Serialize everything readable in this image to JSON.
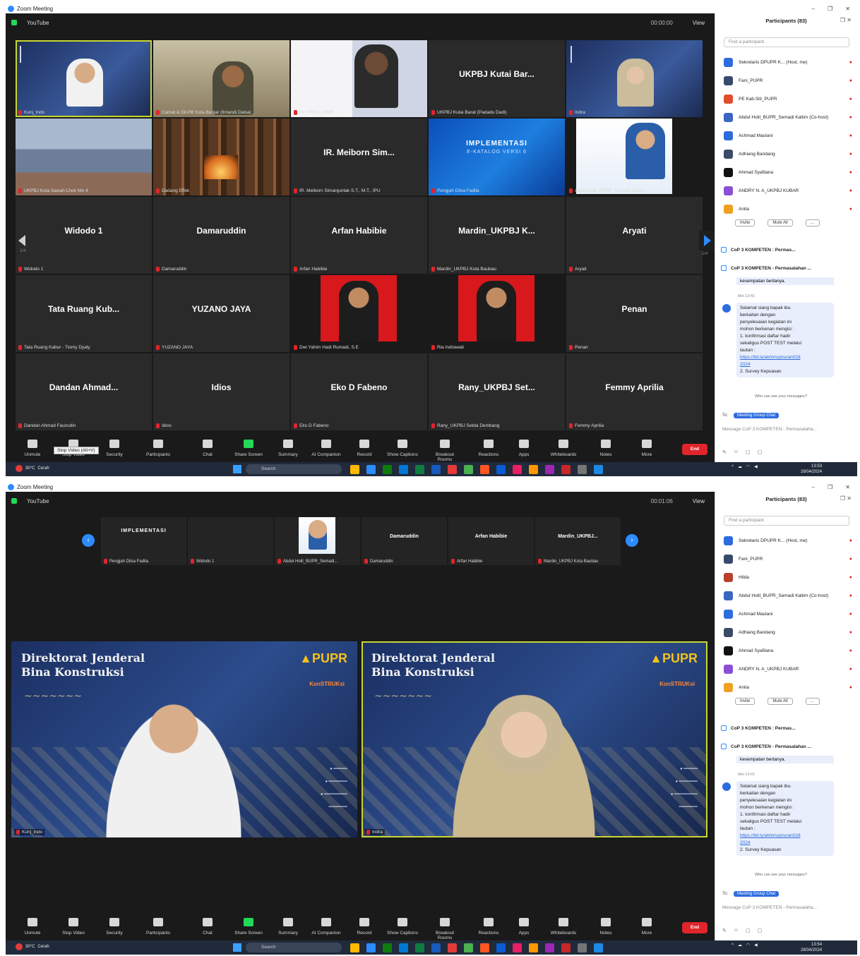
{
  "window": {
    "title": "Zoom Meeting"
  },
  "topbar": {
    "view_selector": "YouTube",
    "view_label": "View"
  },
  "shot1": {
    "tiles": [
      {
        "caption": "Kunj_Indo",
        "label": ""
      },
      {
        "caption": "Camat & Dit.PB Kota Banjar (Ilmandi Dalsa)",
        "label": ""
      },
      {
        "caption": "Dir_PPBJ_CIMB",
        "label": ""
      },
      {
        "caption": "UKPBJ Kutai Barat (Padadu Dadi)",
        "label": "UKPBJ Kutai Bar..."
      },
      {
        "caption": "Indra",
        "label": ""
      },
      {
        "caption": "UKPBJ Kota Sawah Lhok Nin 4",
        "label": ""
      },
      {
        "caption": "Dadang Effek",
        "label": ""
      },
      {
        "caption": "IR. Meiborn Simanjuntak S.T., M.T., IPU",
        "label": "IR. Meiborn Sim..."
      },
      {
        "caption": "Pengjah Dilsa Fadila",
        "label": ""
      },
      {
        "caption": "Abdul Holil_BUPR_Semadi Kaltim",
        "label": ""
      },
      {
        "caption": "Widodo 1",
        "label": "Widodo 1"
      },
      {
        "caption": "Damaruddin",
        "label": "Damaruddin"
      },
      {
        "caption": "Arfan Habibie",
        "label": "Arfan Habibie"
      },
      {
        "caption": "Mardin_UKPBJ Kota Baubau",
        "label": "Mardin_UKPBJ K..."
      },
      {
        "caption": "Aryati",
        "label": "Aryati"
      },
      {
        "caption": "Tata Ruang Kabur - Tiomy Dyaly",
        "label": "Tata Ruang Kub..."
      },
      {
        "caption": "YUZANO JAYA",
        "label": "YUZANO JAYA"
      },
      {
        "caption": "Dwi Yahim Hadi Rumadi, S.E",
        "label": ""
      },
      {
        "caption": "Ria Indrawati",
        "label": ""
      },
      {
        "caption": "Penan",
        "label": "Penan"
      },
      {
        "caption": "Dandan Ahmad Fauzudin",
        "label": "Dandan Ahmad..."
      },
      {
        "caption": "Idios",
        "label": "Idios"
      },
      {
        "caption": "Eko D Fabeno",
        "label": "Eko D Fabeno"
      },
      {
        "caption": "Rany_UKPBJ Setda Dembang",
        "label": "Rany_UKPBJ Set..."
      },
      {
        "caption": "Femmy Aprilia",
        "label": "Femmy Aprilia"
      }
    ],
    "ekatalog_text": "IMPLEMENTASI",
    "ekatalog_sub": "E-KATALOG VERSI 6",
    "tooltip": "Stop Video (Alt+V)",
    "page_left": "1/4",
    "page_right": "1/4",
    "timer": "00:00:00"
  },
  "shot2": {
    "thumbs": [
      {
        "caption": "Pengjah Dilsa Fadila",
        "label": ""
      },
      {
        "caption": "Widodo 1",
        "label": ""
      },
      {
        "caption": "Abdul Holil_BUPR_Semadi...",
        "label": ""
      },
      {
        "caption": "Damaruddin",
        "label": "Damaruddin"
      },
      {
        "caption": "Arfan Habibie",
        "label": "Arfan Habibie"
      },
      {
        "caption": "Mardin_UKPBJ Kota Baubau",
        "label": "Mardin_UKPBJ..."
      }
    ],
    "speakers": [
      {
        "caption": "Kunj_Indo",
        "title1": "Direktorat Jenderal",
        "title2": "Bina Konstruksi"
      },
      {
        "caption": "Indra",
        "title1": "Direktorat Jenderal",
        "title2": "Bina Konstruksi"
      }
    ],
    "timer": "00:01:06"
  },
  "toolbar": {
    "items": [
      "Unmute",
      "Stop Video",
      "Security",
      "Participants",
      "Chat",
      "Share Screen",
      "Summary",
      "AI Companion",
      "Record",
      "Show Captions",
      "Breakout Rooms",
      "Reactions",
      "Apps",
      "Whiteboards",
      "Notes",
      "More"
    ],
    "participants_count": "83",
    "end": "End"
  },
  "participants": {
    "title": "Participants (83)",
    "search_placeholder": "Find a participant",
    "list": [
      {
        "name": "Sekretaris DPUPR K... (Host, me)",
        "color": "#2d6cdf"
      },
      {
        "name": "Fani_PUPR",
        "color": "#374a6b"
      },
      {
        "name": "PE Kab.Siti_PUPR",
        "color": "#e04e2b"
      },
      {
        "name": "Abdul Holil_BUPR_Semadi Kaltim (Co-host)",
        "color": "#3a66c2"
      },
      {
        "name": "Achmad Maulani",
        "color": "#2d6cdf"
      },
      {
        "name": "Adhiang Bandang",
        "color": "#3b4a66"
      },
      {
        "name": "Ahmad Syafiiana",
        "color": "#111111"
      },
      {
        "name": "ANDRY N. A_UKPBJ KUBAR",
        "color": "#8a4fd6"
      },
      {
        "name": "Anita",
        "color": "#f0a020"
      }
    ],
    "list2_third": "Hilda",
    "invite": "Invite",
    "mute_all": "Mute All"
  },
  "chat": {
    "window_title": "CoP 3 KOMPETEN : Permas...",
    "title": "CoP 3 KOMPETEN - Permasalahan ...",
    "prev_text": "kesempatan bertanya.",
    "sender_time": "Mei 13:41",
    "message_lines": [
      "Selamat siang bapak ibu.",
      "berkaitan dengan",
      "penyelesaian kegiatan ini",
      "mohon berkenan mengisi :",
      "1. konfirmasi daftar hadir",
      "sekaligus POST TEST melalui",
      "tautan :"
    ],
    "link": "https://bit.ly/akhirrupiruran028",
    "link2": "2024",
    "survey": "2. Survey Kepuasan",
    "seen": "Who can see your messages?",
    "to_label": "To:",
    "to_chip": "Meeting Group Chat",
    "placeholder": "Message CoP 3 KOMPETEN - Permasalaha..."
  },
  "taskbar": {
    "weather_temp": "30°C",
    "weather_desc": "Cerah",
    "search": "Search",
    "time1": "13:53",
    "time2": "13:54",
    "date": "28/04/2024"
  }
}
